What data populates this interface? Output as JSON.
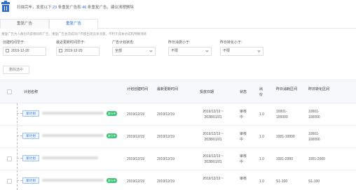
{
  "banner": {
    "icon": "trash-icon",
    "prefix": "扫描完毕，发现以下",
    "count_a": "23",
    "middle": "条重复广告和",
    "count_b": "46",
    "suffix": "条重复广告，建议清理删除"
  },
  "tabs": [
    {
      "label": "重复广告",
      "active": false
    },
    {
      "label": "重复广告",
      "active": true
    }
  ],
  "description": "重复广告为人群包内容相同的广告，重复广告会造成同户内部出现竞争流量，不利于成本达成和预算消耗",
  "filters": {
    "created_label": "创建时间早于:",
    "created_value": "2019-12-20",
    "updated_label": "最近更新时间早于:",
    "updated_value": "2019-12-20",
    "status_label": "广告计划状态:",
    "status_value": "全部",
    "reach_label": "昨日消费小于:",
    "reach_value": "不限",
    "conv_label": "昨日转化小于:",
    "conv_value": "不限"
  },
  "delete_button": "删除选中",
  "table": {
    "headers": {
      "name": "计划名称",
      "created": "计划创建时间",
      "updated": "最新更新时间",
      "dates": "投放日期",
      "status": "状态",
      "price": "出价",
      "reach": "昨日消耗区间",
      "conv": "昨日转化区间"
    },
    "rows": [
      {
        "tag": "新计划",
        "badge": "进行中",
        "created": "2019/12/19",
        "updated": "2019/12/19",
        "dates": "2019/12/19 ~ 2038/01/01",
        "status": "审核中",
        "price": "1.0",
        "reach": "10001-100000",
        "conv": "10001-100000"
      },
      {
        "tag": "新计划",
        "badge": "进行中",
        "created": "2019/12/19",
        "updated": "2019/12/19",
        "dates": "2019/12/19 ~ 2038/01/01",
        "status": "审核中",
        "price": "1.0",
        "reach": "1001-10000",
        "conv": "10001-100000"
      },
      {
        "tag": "新计划",
        "badge": "",
        "created": "2019/12/19",
        "updated": "2019/12/19",
        "dates": "2019/12/19 ~ 2038/01/01",
        "status": "审核中",
        "price": "1.0",
        "reach": "1001-2000",
        "conv": "1001-2000"
      },
      {
        "tag": "新计划",
        "badge": "进行中",
        "created": "2019/12/19",
        "updated": "2019/12/19",
        "dates": "2019/12/19 ~",
        "status": "审核",
        "price": "1.0",
        "reach": "S1-100",
        "conv": "S1-100"
      }
    ]
  },
  "colors": {
    "accent": "#2f6fd3",
    "success": "#38c172"
  }
}
